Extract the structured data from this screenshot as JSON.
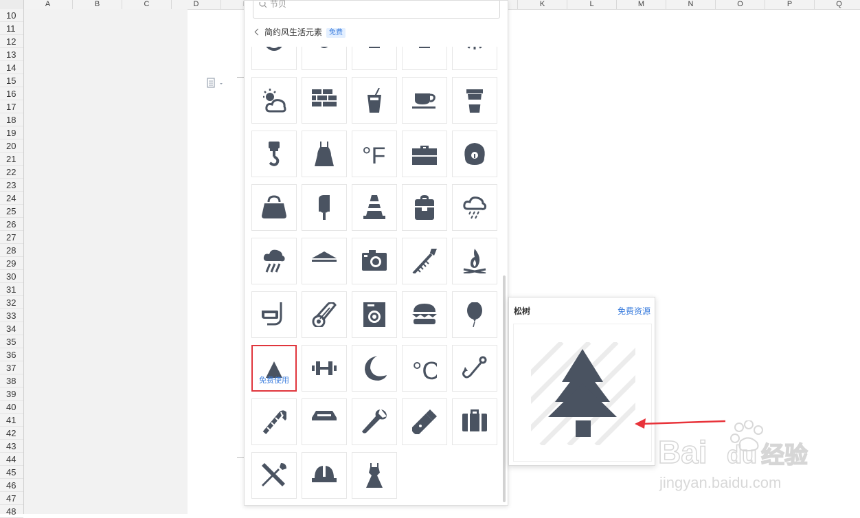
{
  "spreadsheet": {
    "columns": [
      "A",
      "B",
      "C",
      "D",
      "E",
      "F",
      "G",
      "H",
      "I",
      "J",
      "K",
      "L",
      "M",
      "N",
      "O",
      "P",
      "Q"
    ],
    "rows": [
      "10",
      "11",
      "12",
      "13",
      "14",
      "15",
      "16",
      "17",
      "18",
      "19",
      "20",
      "21",
      "22",
      "23",
      "24",
      "25",
      "26",
      "27",
      "28",
      "29",
      "30",
      "31",
      "32",
      "33",
      "34",
      "35",
      "36",
      "37",
      "38",
      "39",
      "40",
      "41",
      "42",
      "43",
      "44",
      "45",
      "46",
      "47",
      "48"
    ]
  },
  "panel": {
    "search_placeholder": "节贝",
    "breadcrumb": "简约风生活元素",
    "breadcrumb_badge": "免费",
    "selected_tile_label": "免费使用",
    "icons": [
      "timer-icon",
      "stopwatch-icon",
      "trophy-icon",
      "goblet-icon",
      "sunrise-icon",
      "partly-cloudy-icon",
      "brick-wall-icon",
      "drink-cup-icon",
      "coffee-cup-icon",
      "takeaway-cup-icon",
      "crane-hook-icon",
      "dress-icon",
      "fahrenheit-icon",
      "toolbox-icon",
      "rice-cooker-icon",
      "handbag-icon",
      "popsicle-icon",
      "traffic-cone-icon",
      "backpack-icon",
      "rain-cloud-icon",
      "heavy-rain-icon",
      "tent-icon",
      "camera-icon",
      "firework-rocket-icon",
      "campfire-icon",
      "diving-mask-icon",
      "thermometer-icon",
      "washing-machine-icon",
      "hamburger-icon",
      "balloon-icon",
      "pine-tree-icon",
      "dumbbell-icon",
      "crescent-moon-icon",
      "celsius-icon",
      "fishing-hook-icon",
      "candy-cane-icon",
      "laptop-box-icon",
      "wrench-icon",
      "flashlight-icon",
      "suitcase-icon",
      "tools-icon",
      "hard-hat-icon",
      "gown-icon"
    ]
  },
  "preview": {
    "title": "松树",
    "link": "免费资源",
    "id": "ID20117077",
    "icon": "pine-tree-icon"
  },
  "watermark": {
    "brand": "Bai du 经验",
    "url": "jingyan.baidu.com"
  },
  "colors": {
    "icon": "#4a5361",
    "accent": "#3b7ddd",
    "selected_border": "#e0353c",
    "arrow": "#e8333a"
  }
}
